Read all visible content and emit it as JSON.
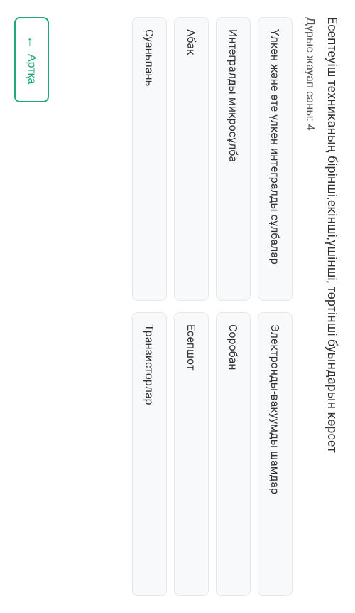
{
  "question": {
    "text": "Есептеуіш техниканың бірінші,екінші,үшінші, төртінші буындарын көрсет",
    "answer_count_label": "Дұрыс жауап саны: 4"
  },
  "column_left": [
    "Үлкен және өте үлкен интегралды сұлбалар",
    "Интегралды микросұлба",
    "Абак",
    "Суаньпань"
  ],
  "column_right": [
    "Электронды-вакуумды шамдар",
    "Соробан",
    "Есепшот",
    "Транзисторлар"
  ],
  "buttons": {
    "back_label": "Артқа",
    "back_arrow": "←"
  }
}
